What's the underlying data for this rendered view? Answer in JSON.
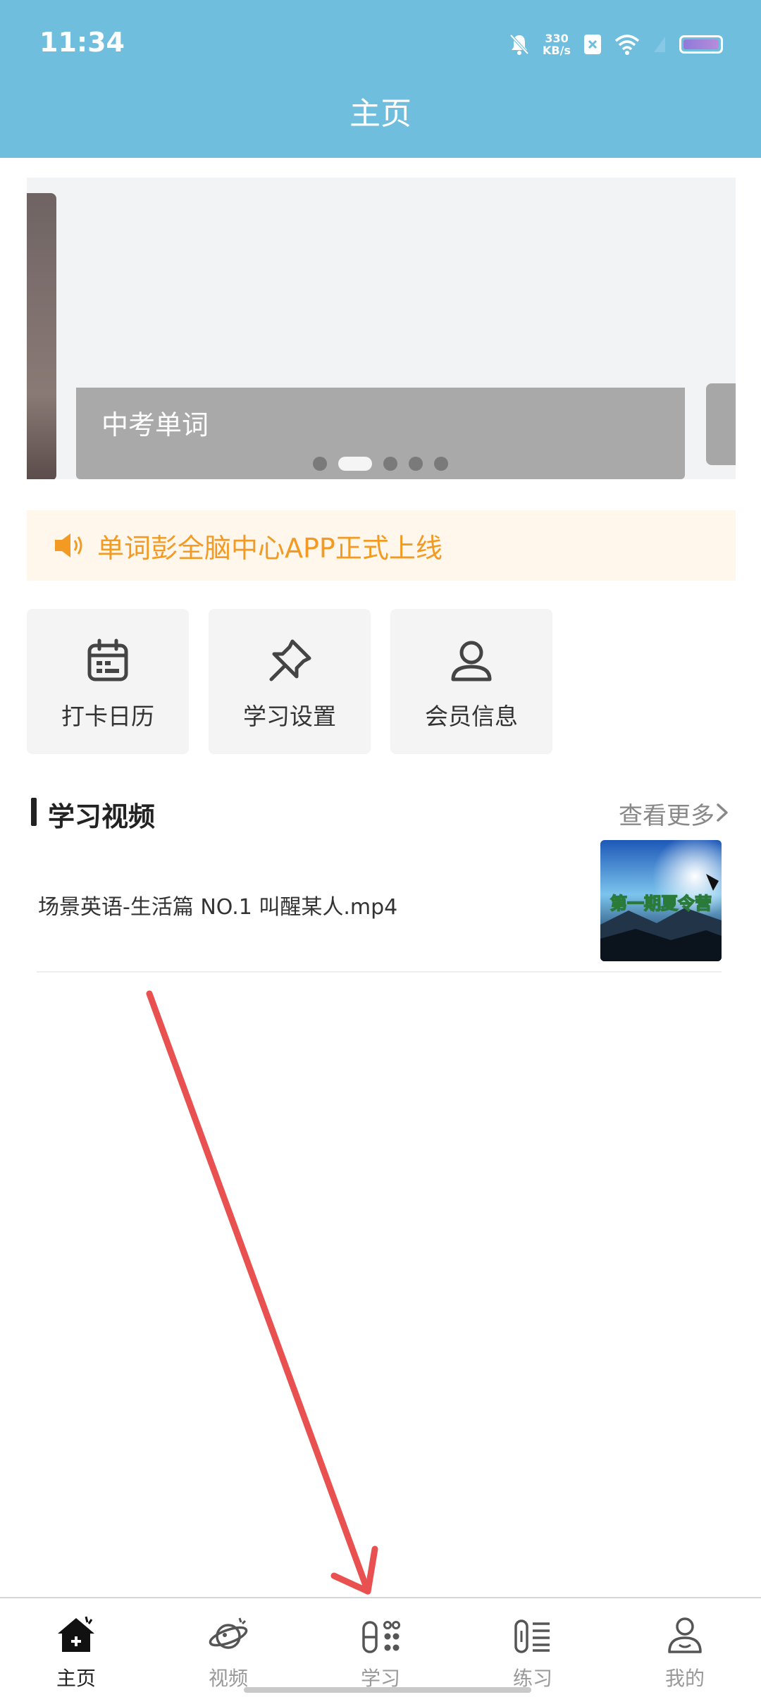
{
  "status_bar": {
    "time": "11:34",
    "net_speed_value": "330",
    "net_speed_unit": "KB/s"
  },
  "header": {
    "title": "主页"
  },
  "banner": {
    "label": "中考单词",
    "active_index": 1,
    "page_count": 5
  },
  "notice": {
    "text": "单词彭全脑中心APP正式上线"
  },
  "quick_actions": [
    {
      "label": "打卡日历",
      "icon": "calendar-icon"
    },
    {
      "label": "学习设置",
      "icon": "pin-icon"
    },
    {
      "label": "会员信息",
      "icon": "user-icon"
    }
  ],
  "video_section": {
    "title": "学习视频",
    "more_label": "查看更多",
    "items": [
      {
        "title": "场景英语-生活篇 NO.1 叫醒某人.mp4",
        "thumb_caption": "第一期夏令营"
      }
    ]
  },
  "tabs": [
    {
      "label": "主页",
      "icon": "home-icon",
      "active": true
    },
    {
      "label": "视频",
      "icon": "planet-icon",
      "active": false
    },
    {
      "label": "学习",
      "icon": "study-icon",
      "active": false
    },
    {
      "label": "练习",
      "icon": "practice-icon",
      "active": false
    },
    {
      "label": "我的",
      "icon": "profile-icon",
      "active": false
    }
  ],
  "colors": {
    "header_bg": "#6fbede",
    "notice_text": "#f29a22",
    "annotation_arrow": "#e8514f"
  }
}
